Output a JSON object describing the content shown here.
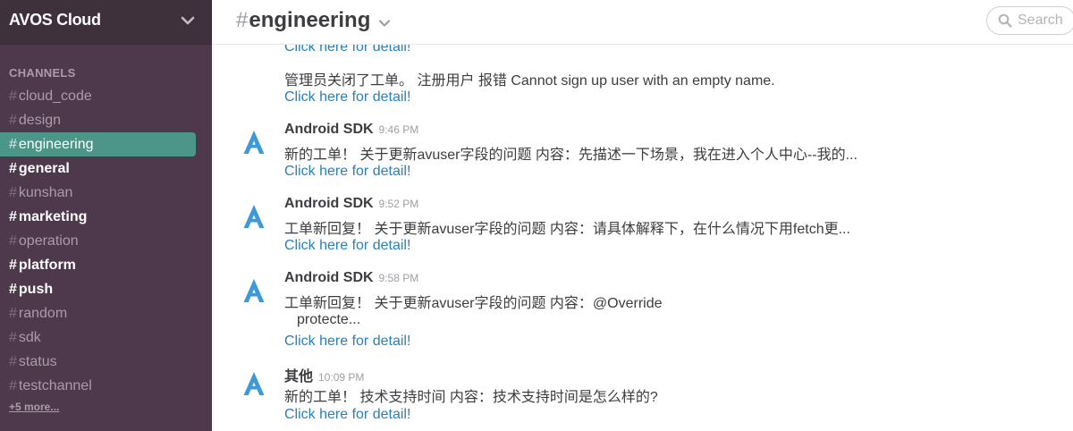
{
  "sidebar": {
    "team_name": "AVOS Cloud",
    "channels_heading": "CHANNELS",
    "hash": "#",
    "channels": [
      {
        "name": "cloud_code",
        "state": "normal"
      },
      {
        "name": "design",
        "state": "normal"
      },
      {
        "name": "engineering",
        "state": "active"
      },
      {
        "name": "general",
        "state": "unread"
      },
      {
        "name": "kunshan",
        "state": "normal"
      },
      {
        "name": "marketing",
        "state": "unread"
      },
      {
        "name": "operation",
        "state": "normal"
      },
      {
        "name": "platform",
        "state": "unread"
      },
      {
        "name": "push",
        "state": "unread"
      },
      {
        "name": "random",
        "state": "normal"
      },
      {
        "name": "sdk",
        "state": "normal"
      },
      {
        "name": "status",
        "state": "normal"
      },
      {
        "name": "testchannel",
        "state": "normal"
      }
    ],
    "more_link": "+5 more..."
  },
  "header": {
    "hash": "#",
    "channel_name": "engineering",
    "search_placeholder": "Search"
  },
  "colors": {
    "sidebar_bg": "#4d394b",
    "active_channel": "#4c9689",
    "link": "#2a80b9",
    "avatar": "#3d9ad6"
  },
  "messages": {
    "top_link": "Click here for detail!",
    "continuation": {
      "text": "管理员关闭了工单。 注册用户 报错 Cannot sign up user with an empty name.",
      "link": "Click here for detail!"
    },
    "items": [
      {
        "sender": "Android SDK",
        "time": "9:46 PM",
        "line1": "新的工单！ 关于更新avuser字段的问题 内容：先描述一下场景，我在进入个人中心--我的...",
        "link": "Click here for detail!"
      },
      {
        "sender": "Android SDK",
        "time": "9:52 PM",
        "line1": "工单新回复！ 关于更新avuser字段的问题 内容：请具体解释下，在什么情况下用fetch更...",
        "link": "Click here for detail!"
      },
      {
        "sender": "Android SDK",
        "time": "9:58 PM",
        "line1": "工单新回复！ 关于更新avuser字段的问题 内容：@Override",
        "line2": "protecte...",
        "link": "Click here for detail!"
      },
      {
        "sender": "其他",
        "time": "10:09 PM",
        "line1": "新的工单！ 技术支持时间 内容：技术支持时间是怎么样的?",
        "link": "Click here for detail!"
      }
    ]
  }
}
